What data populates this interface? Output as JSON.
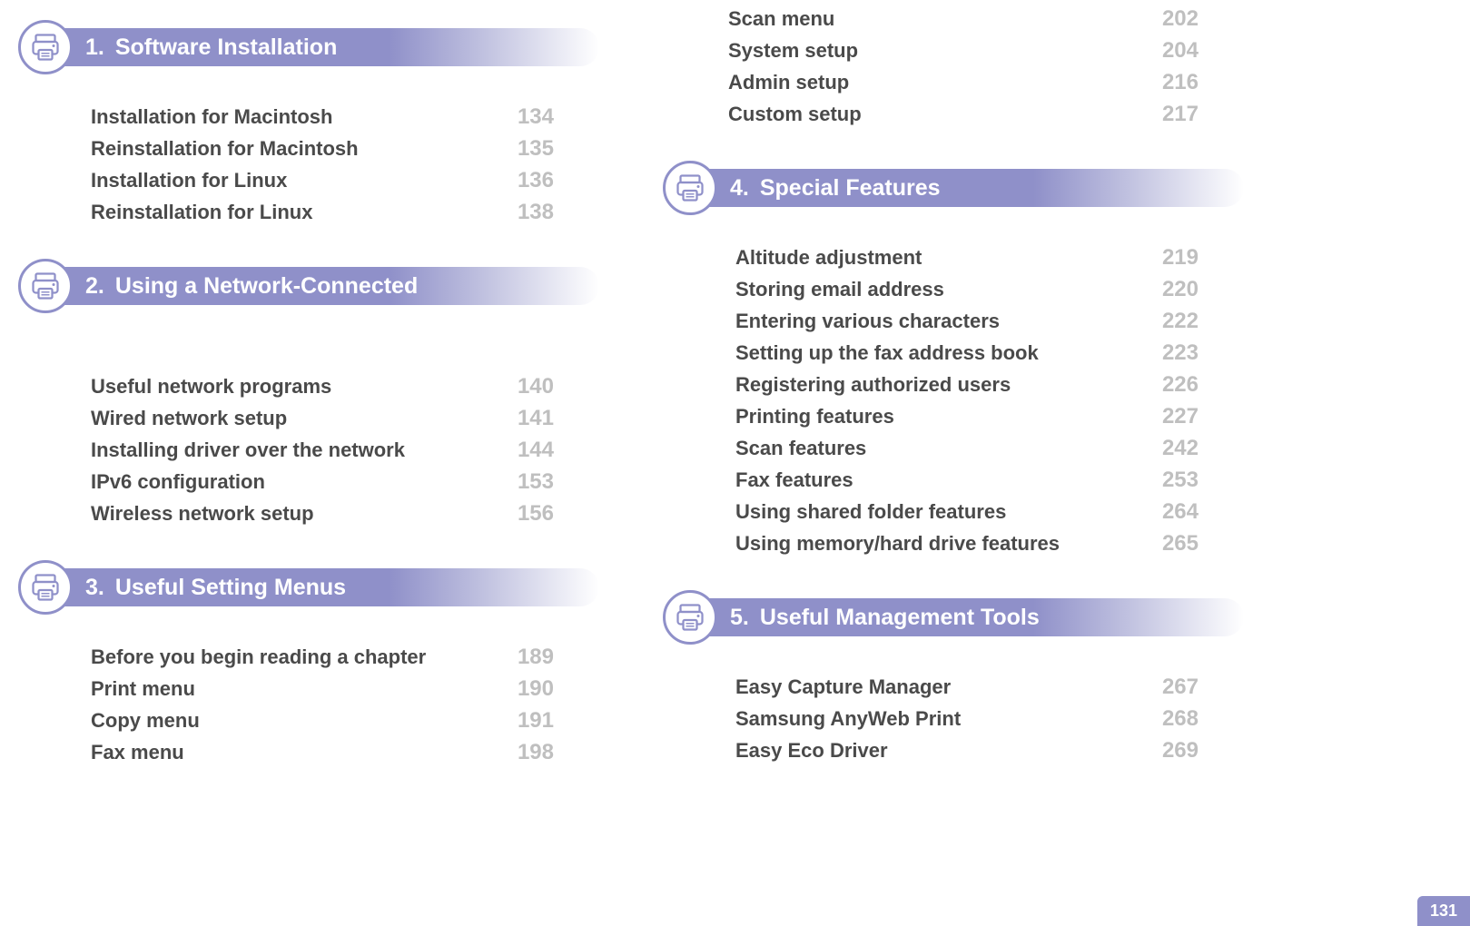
{
  "page_number": "131",
  "left_column": {
    "sections": [
      {
        "num": "1.",
        "title": "Software Installation",
        "items": [
          {
            "label": "Installation for Macintosh",
            "page": "134"
          },
          {
            "label": "Reinstallation for Macintosh",
            "page": "135"
          },
          {
            "label": "Installation for Linux",
            "page": "136"
          },
          {
            "label": "Reinstallation for Linux",
            "page": "138"
          }
        ]
      },
      {
        "num": "2.",
        "title": "Using a Network-Connected",
        "items": [
          {
            "label": "Useful network programs",
            "page": "140"
          },
          {
            "label": "Wired network setup",
            "page": "141"
          },
          {
            "label": "Installing driver over the network",
            "page": "144"
          },
          {
            "label": "IPv6 configuration",
            "page": "153"
          },
          {
            "label": "Wireless network setup",
            "page": "156"
          }
        ]
      },
      {
        "num": "3.",
        "title": "Useful Setting Menus",
        "items": [
          {
            "label": "Before you begin reading a chapter",
            "page": "189"
          },
          {
            "label": "Print menu",
            "page": "190"
          },
          {
            "label": "Copy menu",
            "page": "191"
          },
          {
            "label": "Fax menu",
            "page": "198"
          }
        ]
      }
    ]
  },
  "right_column": {
    "orphan_items": [
      {
        "label": "Scan menu",
        "page": "202"
      },
      {
        "label": "System setup",
        "page": "204"
      },
      {
        "label": "Admin setup",
        "page": "216"
      },
      {
        "label": "Custom setup",
        "page": "217"
      }
    ],
    "sections": [
      {
        "num": "4.",
        "title": "Special Features",
        "items": [
          {
            "label": "Altitude adjustment",
            "page": "219"
          },
          {
            "label": "Storing email address",
            "page": "220"
          },
          {
            "label": "Entering various characters",
            "page": "222"
          },
          {
            "label": "Setting up the fax address book",
            "page": "223"
          },
          {
            "label": "Registering authorized users",
            "page": "226"
          },
          {
            "label": "Printing features",
            "page": "227"
          },
          {
            "label": "Scan features",
            "page": "242"
          },
          {
            "label": "Fax features",
            "page": "253"
          },
          {
            "label": "Using shared folder features",
            "page": "264"
          },
          {
            "label": "Using memory/hard drive features",
            "page": "265"
          }
        ]
      },
      {
        "num": "5.",
        "title": "Useful Management Tools",
        "items": [
          {
            "label": "Easy Capture Manager",
            "page": "267"
          },
          {
            "label": "Samsung AnyWeb Print",
            "page": "268"
          },
          {
            "label": "Easy Eco Driver",
            "page": "269"
          }
        ]
      }
    ]
  }
}
